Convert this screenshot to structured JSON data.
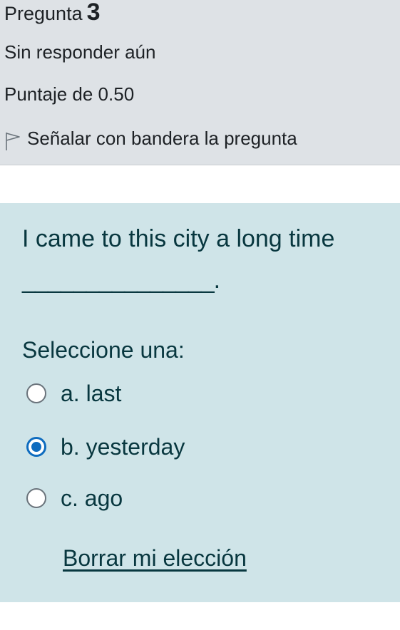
{
  "question_info": {
    "label": "Pregunta",
    "number": "3",
    "state": "Sin responder aún",
    "grade": "Puntaje de 0.50",
    "flag_label": "Señalar con bandera la pregunta",
    "flag_icon": "flag-outline-icon"
  },
  "question": {
    "text": "I came to this city a long time",
    "blank": "_______________.",
    "prompt": "Seleccione una:",
    "options": [
      {
        "label": "a. last",
        "selected": false
      },
      {
        "label": "b. yesterday",
        "selected": true
      },
      {
        "label": "c. ago",
        "selected": false
      }
    ],
    "clear_label": "Borrar mi elección"
  },
  "colors": {
    "info_background": "#dee2e6",
    "content_background": "#cfe4e8",
    "text_dark": "#08373f",
    "radio_selected": "#0f6cbf"
  }
}
